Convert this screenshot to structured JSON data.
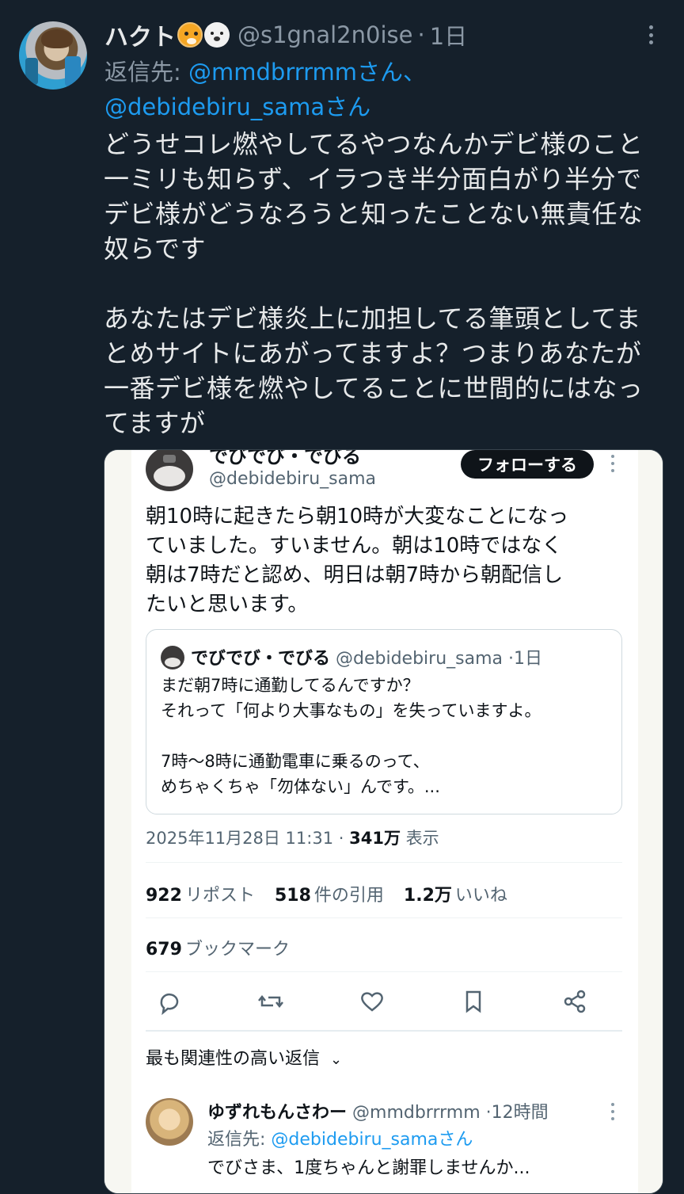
{
  "post": {
    "display_name": "ハクト",
    "emojis": [
      "tiger-emoji",
      "polar-bear-emoji"
    ],
    "handle": "@s1gnal2n0ise",
    "separator": "·",
    "time": "1日",
    "reply_to_prefix": "返信先: ",
    "reply_to_user1": "@mmdbrrrmmさん、",
    "reply_to_user2": "@debidebiru_samaさん",
    "body_lines_1": [
      "どうせコレ燃やしてるやつなんかデビ様のこと",
      "一ミリも知らず、イラつき半分面白がり半分で",
      "デビ様がどうなろうと知ったことない無責任な",
      "奴らです"
    ],
    "body_lines_2": [
      "あなたはデビ様炎上に加担してる筆頭としてま",
      "とめサイトにあがってますよ？つまりあなたが",
      "一番デビ様を燃やしてることに世間的にはなっ",
      "てますが"
    ]
  },
  "screenshot": {
    "name": "でびでび・でびる",
    "handle": "@debidebiru_sama",
    "follow_label": "フォローする",
    "text_lines": [
      "朝10時に起きたら朝10時が大変なことになっ",
      "ていました。すいません。朝は10時ではなく",
      "朝は7時だと認め、明日は朝7時から朝配信し",
      "たいと思います。"
    ],
    "quote": {
      "name": "でびでび・でびる",
      "handle": "@debidebiru_sama",
      "separator": "·",
      "time": "1日",
      "lines": [
        "まだ朝7時に通勤してるんですか？",
        "それって「何より大事なもの」を失っていますよ。",
        "",
        "7時〜8時に通勤電車に乗るのって、",
        "めちゃくちゃ「勿体ない」んです。..."
      ]
    },
    "timestamp": "2025年11月28日 11:31 · ",
    "views_count": "341万",
    "views_label": " 表示",
    "reposts_count": "922",
    "reposts_label": "リポスト",
    "quotes_count": "518",
    "quotes_label": "件の引用",
    "likes_count": "1.2万",
    "likes_label": "いいね",
    "bookmarks_count": "679",
    "bookmarks_label": "ブックマーク",
    "relevant_label": "最も関連性の高い返信",
    "reply": {
      "name": "ゆずれもんさわー",
      "handle": "@mmdbrrrmm",
      "separator": "·",
      "time": "12時間",
      "reply_to_prefix": "返信先: ",
      "reply_to_user": "@debidebiru_samaさん",
      "text": "でびさま、1度ちゃんと謝罪しませんか..."
    }
  },
  "colors": {
    "background": "#15202b",
    "text": "#e7e9ea",
    "muted": "#8b98a5",
    "link": "#1d9bf0"
  }
}
